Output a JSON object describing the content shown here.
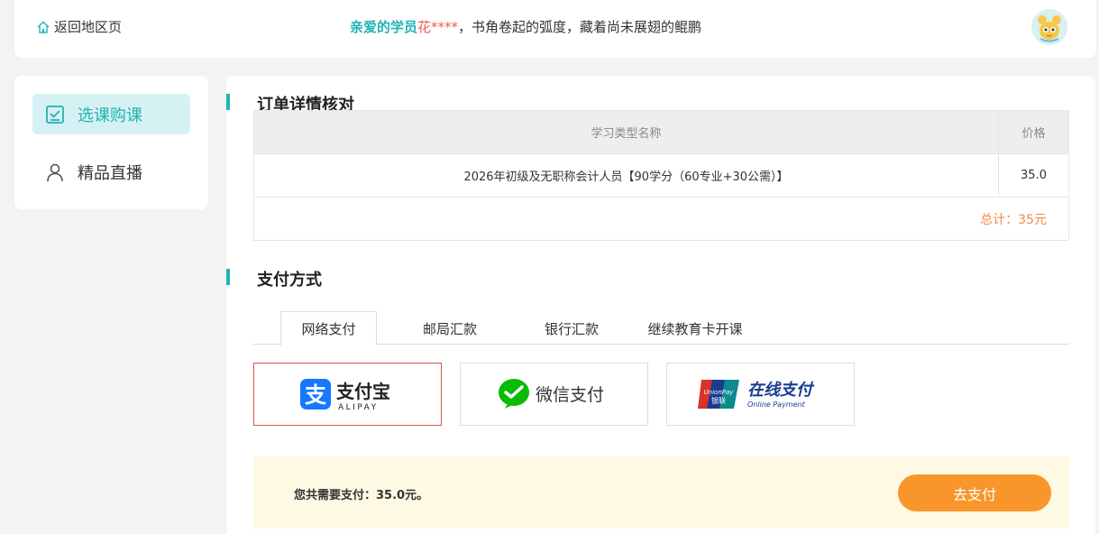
{
  "header": {
    "back_label": "返回地区页",
    "greeting_lead": "亲爱的学员",
    "student_name": "花****",
    "slogan": "，书角卷起的弧度，藏着尚未展翅的鲲鹏"
  },
  "sidebar": {
    "items": [
      {
        "label": "选课购课",
        "icon": "checklist-icon",
        "active": true
      },
      {
        "label": "精品直播",
        "icon": "user-icon",
        "active": false
      }
    ]
  },
  "order": {
    "title": "订单详情核对",
    "columns": [
      "学习类型名称",
      "价格"
    ],
    "rows": [
      {
        "name": "2026年初级及无职称会计人员【90学分（60专业+30公需）】",
        "price": "35.0"
      }
    ],
    "total": "总计：35元"
  },
  "payment": {
    "title": "支付方式",
    "tabs": [
      "网络支付",
      "邮局汇款",
      "银行汇款",
      "继续教育卡开课"
    ],
    "active_tab": 0,
    "methods": [
      {
        "name": "支付宝",
        "sub": "ALIPAY",
        "icon": "alipay-logo",
        "color": "#1677ff",
        "selected": true
      },
      {
        "name": "微信支付",
        "icon": "wechat-pay-logo",
        "color": "#09bb07",
        "selected": false
      },
      {
        "name": "在线支付",
        "sub": "Online Payment",
        "badge_top": "UnionPay",
        "badge_bottom": "银联",
        "icon": "unionpay-logo",
        "color": "#1a3c8f",
        "selected": false
      }
    ],
    "amount_text": "您共需要支付：35.0元。",
    "pay_button": "去支付"
  },
  "colors": {
    "accent": "#1fb3b4",
    "name_red": "#ee5a50",
    "pay_button": "#f8962b",
    "total_orange": "#f08c4a",
    "paybar_bg": "#fef9e2"
  }
}
